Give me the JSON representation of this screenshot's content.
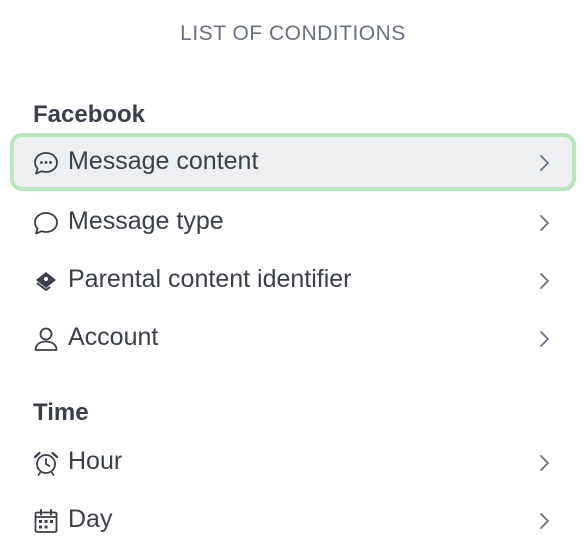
{
  "header": {
    "title": "LIST OF CONDITIONS"
  },
  "sections": [
    {
      "title": "Facebook",
      "items": [
        {
          "label": "Message content",
          "icon": "message-content-icon",
          "selected": true
        },
        {
          "label": "Message type",
          "icon": "message-bubble-icon",
          "selected": false
        },
        {
          "label": "Parental content identifier",
          "icon": "tag-icon",
          "selected": false
        },
        {
          "label": "Account",
          "icon": "user-icon",
          "selected": false
        }
      ]
    },
    {
      "title": "Time",
      "items": [
        {
          "label": "Hour",
          "icon": "alarm-clock-icon",
          "selected": false
        },
        {
          "label": "Day",
          "icon": "calendar-icon",
          "selected": false
        }
      ]
    }
  ],
  "colors": {
    "selected_background": "#eeeff1",
    "selected_border": "#b7e6bd",
    "text": "#3b3f4a",
    "header_text": "#6b7080"
  }
}
